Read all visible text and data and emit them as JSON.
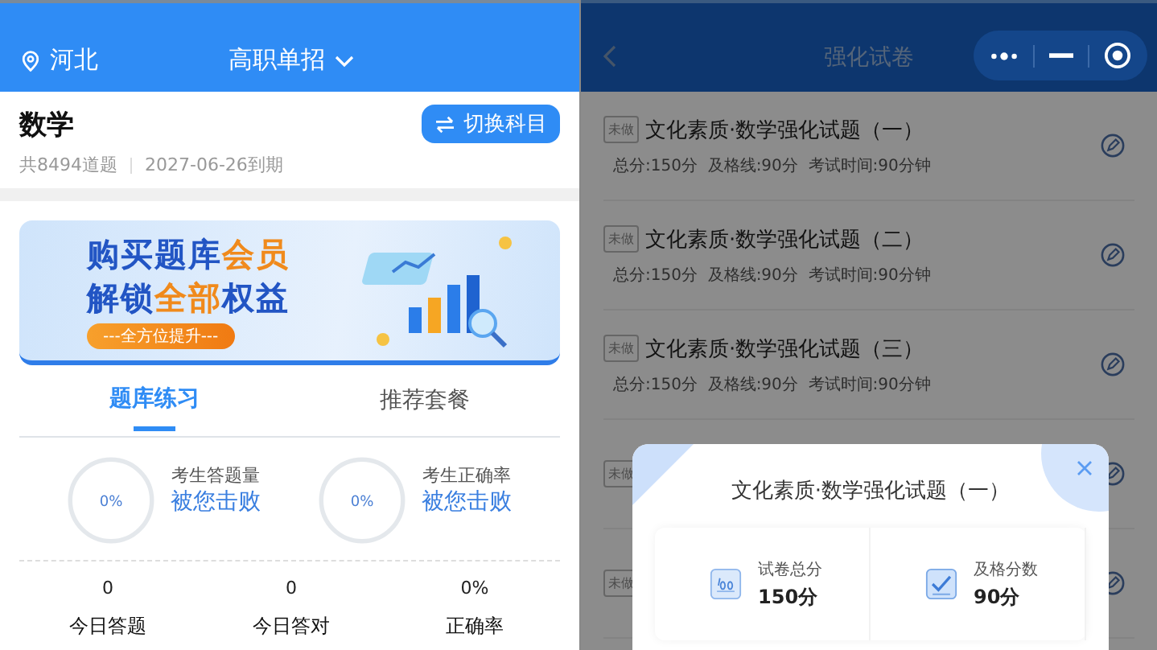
{
  "left": {
    "header": {
      "location": "河北",
      "category": "高职单招"
    },
    "subject": {
      "name": "数学",
      "switch_button": "切换科目",
      "count": "共8494道题",
      "expiry": "2027-06-26到期"
    },
    "banner": {
      "lines": [
        [
          {
            "text": "购买题库",
            "accent": false
          },
          {
            "text": "会员",
            "accent": true
          }
        ],
        [
          {
            "text": "解锁",
            "accent": false
          },
          {
            "text": "全部",
            "accent": true
          },
          {
            "text": "权益",
            "accent": false
          }
        ]
      ],
      "pill": "---全方位提升---"
    },
    "tabs": [
      {
        "label": "题库练习",
        "selected": true
      },
      {
        "label": "推荐套餐",
        "selected": false
      }
    ],
    "rings": [
      {
        "percent": "0%",
        "level": 0,
        "caption": "考生答题量",
        "result": "被您击败"
      },
      {
        "percent": "0%",
        "level": 0,
        "caption": "考生正确率",
        "result": "被您击败"
      }
    ],
    "stats": [
      {
        "value": "0",
        "label": "今日答题"
      },
      {
        "value": "0",
        "label": "今日答对"
      },
      {
        "value": "0%",
        "label": "正确率"
      }
    ]
  },
  "right": {
    "title": "强化试卷",
    "papers": [
      {
        "status": "未做",
        "title": "文化素质·数学强化试题（一）",
        "meta": "总分:150分  及格线:90分  考试时间:90分钟"
      },
      {
        "status": "未做",
        "title": "文化素质·数学强化试题（二）",
        "meta": "总分:150分  及格线:90分  考试时间:90分钟"
      },
      {
        "status": "未做",
        "title": "文化素质·数学强化试题（三）",
        "meta": "总分:150分  及格线:90分  考试时间:90分钟"
      },
      {
        "status": "未做"
      },
      {
        "status": "未做"
      }
    ],
    "dialog": {
      "title": "文化素质·数学强化试题（一）",
      "items": [
        {
          "kind": "score",
          "label": "试卷总分",
          "value": "150分"
        },
        {
          "kind": "pass",
          "label": "及格分数",
          "value": "90分"
        }
      ]
    }
  }
}
